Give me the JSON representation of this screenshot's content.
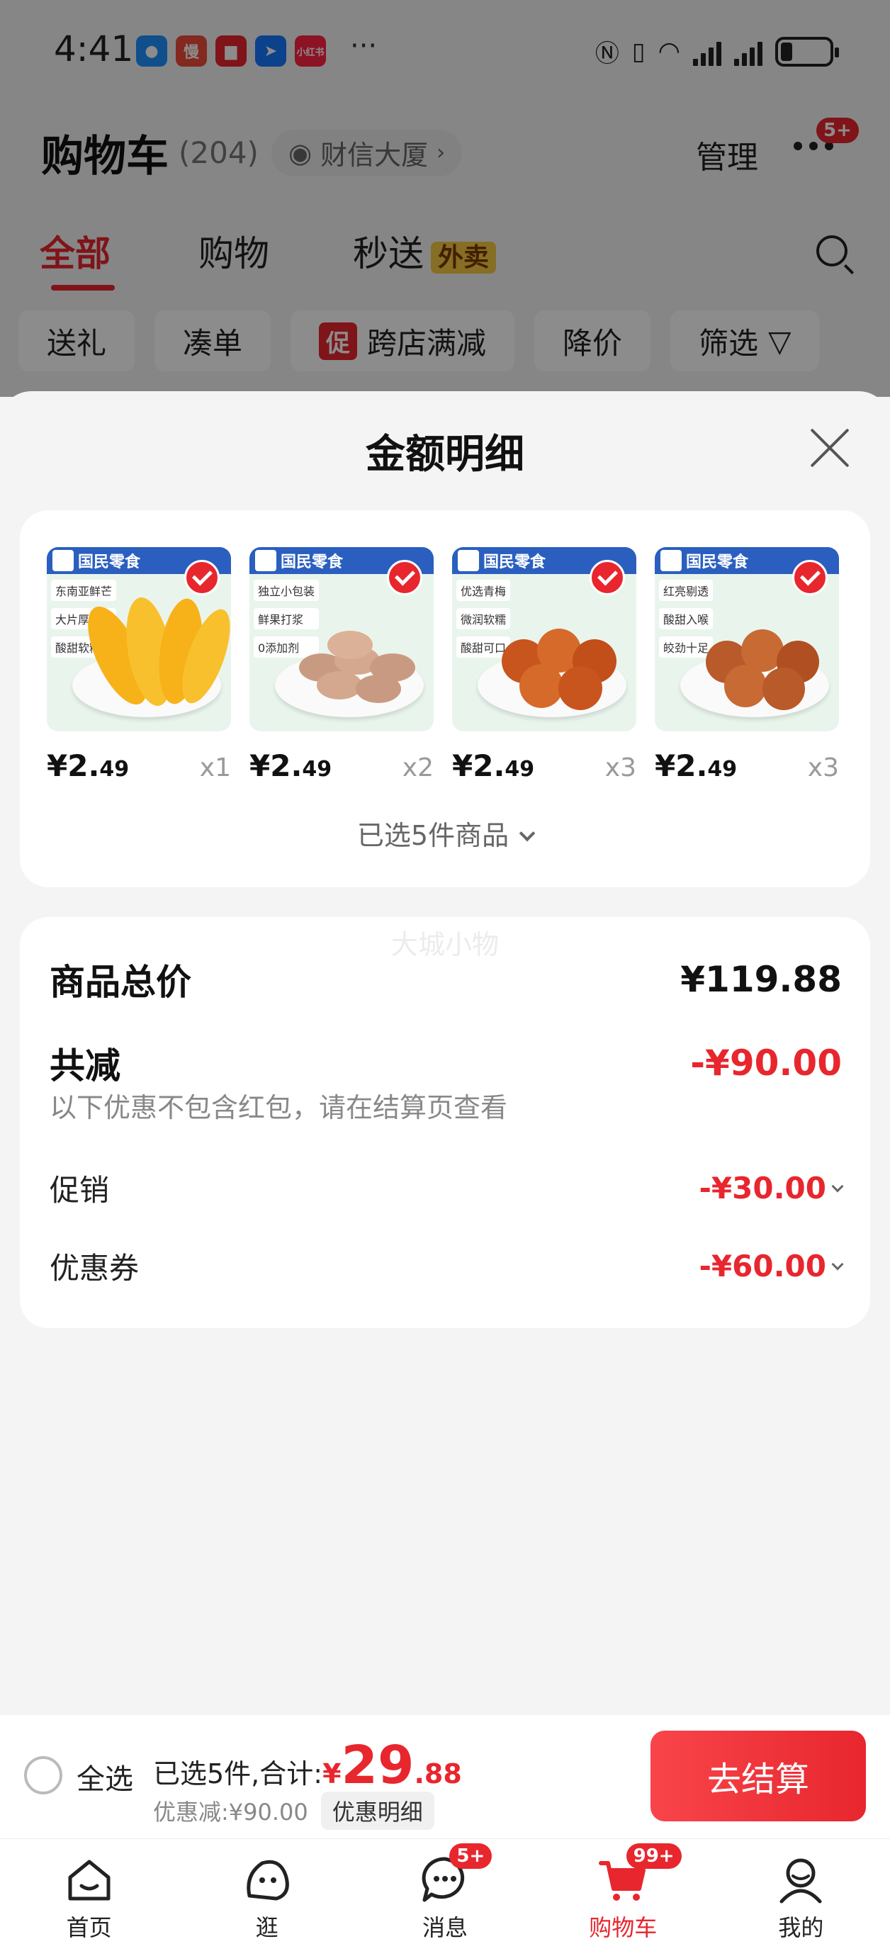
{
  "status_bar": {
    "time": "4:41",
    "apps": [
      {
        "name": "messages-app-icon",
        "glyph": "●",
        "color": "#1e90ff"
      },
      {
        "name": "man-app-icon",
        "glyph": "慢",
        "color": "#ef4b3a"
      },
      {
        "name": "book-app-icon",
        "glyph": "▆",
        "color": "#e8262e"
      },
      {
        "name": "feishu-app-icon",
        "glyph": "➤",
        "color": "#1677ff"
      },
      {
        "name": "xiaohongshu-app-icon",
        "glyph": "小红书",
        "color": "#ff2442"
      }
    ],
    "more": "···"
  },
  "header": {
    "title": "购物车",
    "count": "(204)",
    "location": "财信大厦",
    "manage": "管理",
    "more_badge": "5+"
  },
  "tabs": [
    {
      "label": "全部",
      "active": true
    },
    {
      "label": "购物",
      "active": false
    },
    {
      "label": "秒送",
      "active": false,
      "tag": "外卖"
    }
  ],
  "chips": [
    {
      "label": "送礼"
    },
    {
      "label": "凑单"
    },
    {
      "label": "跨店满减",
      "tag": "促"
    },
    {
      "label": "降价"
    },
    {
      "label": "筛选"
    }
  ],
  "sheet": {
    "title": "金额明细",
    "products": [
      {
        "price_int": "¥2.",
        "price_dec": "49",
        "qty": "x1",
        "brand": "国民零食",
        "tags": [
          "东南亚鲜芒",
          "大片厚切",
          "酸甜软糯"
        ],
        "food": "mango"
      },
      {
        "price_int": "¥2.",
        "price_dec": "49",
        "qty": "x2",
        "brand": "国民零食",
        "tags": [
          "独立小包装",
          "鲜果打浆",
          "0添加剂"
        ],
        "food": "hawthorn"
      },
      {
        "price_int": "¥2.",
        "price_dec": "49",
        "qty": "x3",
        "brand": "国民零食",
        "tags": [
          "优选青梅",
          "微润软糯",
          "酸甜可口"
        ],
        "food": "plum"
      },
      {
        "price_int": "¥2.",
        "price_dec": "49",
        "qty": "x3",
        "brand": "国民零食",
        "tags": [
          "红亮剔透",
          "酸甜入喉",
          "皎劲十足"
        ],
        "food": "plum2"
      }
    ],
    "selected_toggle": "已选5件商品",
    "watermark": "大城小物",
    "total_label": "商品总价",
    "total_value": "¥119.88",
    "reduce_label": "共减",
    "reduce_value": "-¥90.00",
    "reduce_note": "以下优惠不包含红包，请在结算页查看",
    "promo_label": "促销",
    "promo_value": "-¥30.00",
    "coupon_label": "优惠券",
    "coupon_value": "-¥60.00"
  },
  "checkout": {
    "select_all": "全选",
    "summary_prefix": "已选5件,合计:",
    "total_currency": "¥",
    "total_int": "29",
    "total_dec": ".88",
    "discount": "优惠减:¥90.00",
    "detail": "优惠明细",
    "button": "去结算"
  },
  "tabbar": [
    {
      "label": "首页",
      "icon": "home-icon"
    },
    {
      "label": "逛",
      "icon": "browse-icon"
    },
    {
      "label": "消息",
      "icon": "message-icon",
      "badge": "5+"
    },
    {
      "label": "购物车",
      "icon": "cart-icon",
      "badge": "99+",
      "active": true
    },
    {
      "label": "我的",
      "icon": "profile-icon"
    }
  ],
  "colors": {
    "accent": "#e8262e",
    "brand_banner": "#2b5fbf",
    "tag_yellow": "#f5c842"
  }
}
